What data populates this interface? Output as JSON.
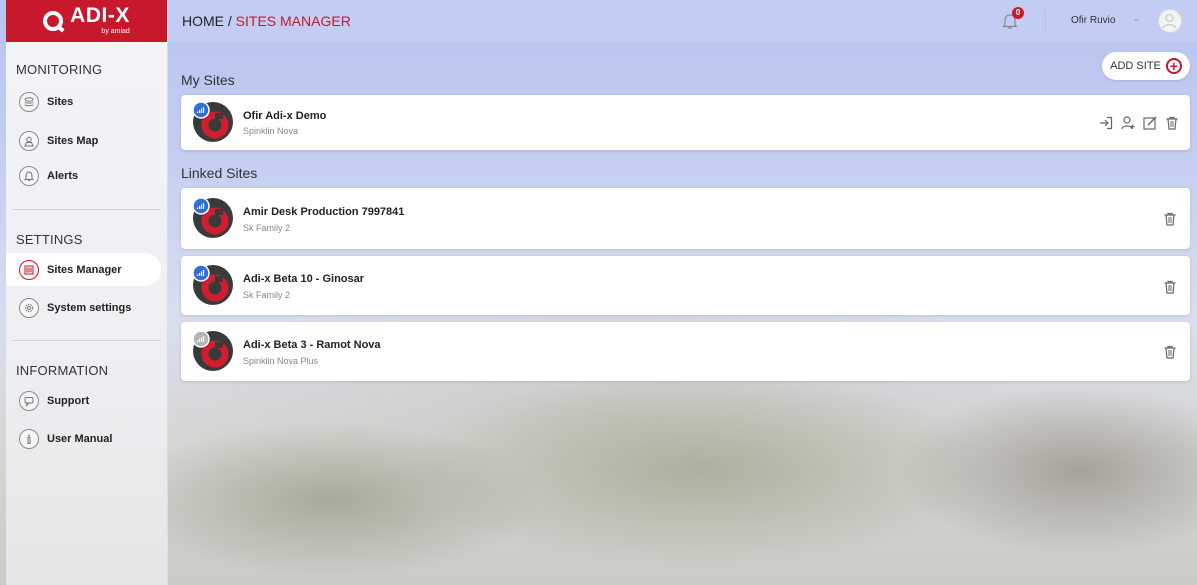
{
  "app": {
    "logo_text": "ADI-X",
    "logo_sub": "by amiad"
  },
  "header": {
    "breadcrumb_home": "HOME /",
    "breadcrumb_current": "SITES MANAGER",
    "notification_count": "0",
    "user_name": "Ofir Ruvio",
    "user_chevron": "⌄"
  },
  "sidebar": {
    "monitoring_title": "MONITORING",
    "monitoring_items": [
      {
        "label": "Sites",
        "icon": "layers-icon"
      },
      {
        "label": "Sites Map",
        "icon": "map-pin-icon"
      },
      {
        "label": "Alerts",
        "icon": "bell-icon"
      }
    ],
    "settings_title": "SETTINGS",
    "settings_items": [
      {
        "label": "Sites Manager",
        "icon": "building-icon",
        "active": true
      },
      {
        "label": "System settings",
        "icon": "gear-icon"
      }
    ],
    "information_title": "INFORMATION",
    "information_items": [
      {
        "label": "Support",
        "icon": "chat-icon"
      },
      {
        "label": "User Manual",
        "icon": "info-person-icon"
      }
    ]
  },
  "main": {
    "my_sites_title": "My Sites",
    "add_site_label": "ADD SITE",
    "linked_sites_title": "Linked Sites",
    "my_sites": [
      {
        "name": "Ofir Adi-x Demo",
        "product": "Spinklin Nova",
        "signal": "online"
      }
    ],
    "linked_sites": [
      {
        "name": "Amir Desk Production 7997841",
        "product": "Sk Family 2",
        "signal": "online"
      },
      {
        "name": "Adi-x Beta 10 - Ginosar",
        "product": "Sk Family 2",
        "signal": "online"
      },
      {
        "name": "Adi-x Beta 3 - Ramot Nova",
        "product": "Spinklin Nova Plus",
        "signal": "offline"
      }
    ]
  },
  "colors": {
    "brand_red": "#c8182c",
    "signal_online": "#2f6fd6",
    "signal_offline": "#b5b5b5"
  }
}
